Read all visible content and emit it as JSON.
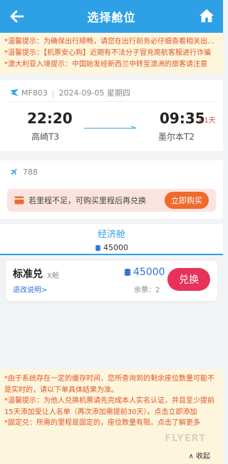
{
  "header": {
    "title": "选择舱位"
  },
  "top_notices": [
    "*温馨提示：为确保出行顺畅，请您在出行前务必仔细查看相关出行要求",
    "*温馨提示：【机票安心购】近期有不法分子冒充南航客服进行诈骗",
    "*澳大利亚入境提示：中国始发经新西兰中转至澳洲的旅客请注意"
  ],
  "flight": {
    "number": "MF803",
    "date": "2024-09-05 星期四",
    "dep_time": "22:20",
    "dep_airport": "高崎T3",
    "arr_time": "09:35",
    "arr_day_offset": "+1天",
    "arr_airport": "墨尔本T2",
    "aircraft": "788"
  },
  "promo": {
    "text": "若里程不足，可购买里程后再兑换",
    "button": "立即购买"
  },
  "cabin": {
    "name": "经济舱",
    "miles": "45000"
  },
  "fare": {
    "name": "标准兑",
    "class": "X舱",
    "policy_link": "退改说明>",
    "miles": "45000",
    "remaining": "余票：2",
    "button": "兑换"
  },
  "bottom_notices": [
    "*由于系统存在一定的缓存时间，您所查询到的剩余座位数量可能不是实时的，请以下单具体结果为准。",
    "*温馨提示：为他人兑换机票请先完成本人实名认证，并且至少提前15天添加受让人名单（再次添加需提前30天）。点击立即添加",
    "*固定兑：所需的里程是固定的，座位数量有限。点击了解更多"
  ],
  "collapse_label": "∧ 收起",
  "watermark": "FLYERT",
  "colors": {
    "header": "#2ea1e6",
    "notice_text": "#e0552b",
    "notice_bg": "#fdf6dc",
    "redeem_button": "#e8325a",
    "buy_button": "#f06a2e",
    "link": "#2e74d6"
  }
}
